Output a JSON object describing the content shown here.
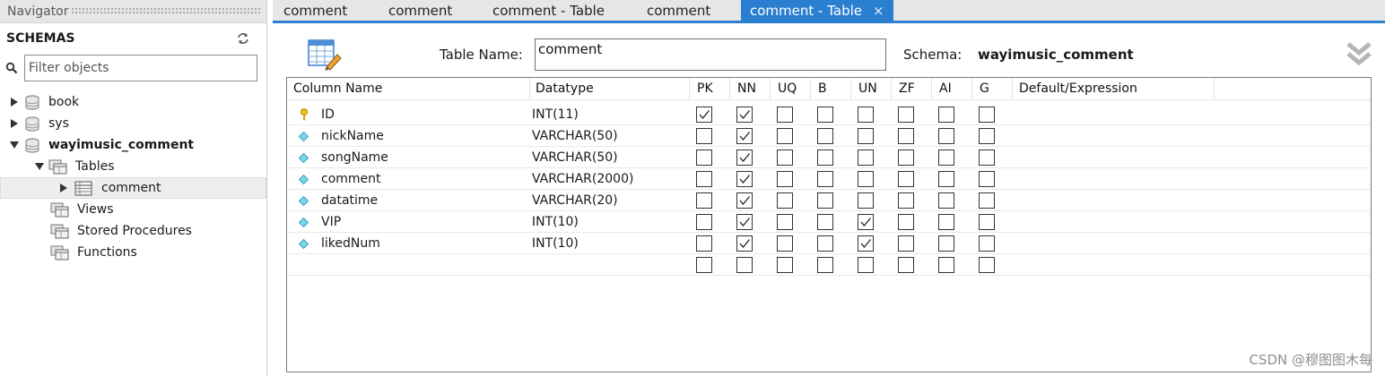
{
  "navigator": {
    "header": "Navigator",
    "schemas_title": "SCHEMAS",
    "filter_placeholder": "Filter objects",
    "schemas": [
      {
        "name": "book"
      },
      {
        "name": "sys"
      },
      {
        "name": "wayimusic_comment"
      }
    ],
    "nodes": {
      "tables": "Tables",
      "table_comment": "comment",
      "views": "Views",
      "stored_procedures": "Stored Procedures",
      "functions": "Functions"
    }
  },
  "tabs": [
    {
      "label": "comment"
    },
    {
      "label": "comment"
    },
    {
      "label": "comment - Table"
    },
    {
      "label": "comment"
    },
    {
      "label": "comment - Table",
      "active": true,
      "close": "×"
    }
  ],
  "editor": {
    "table_name_label": "Table Name:",
    "table_name_value": "comment",
    "schema_label": "Schema:",
    "schema_value": "wayimusic_comment"
  },
  "grid": {
    "headers": {
      "column_name": "Column Name",
      "datatype": "Datatype",
      "pk": "PK",
      "nn": "NN",
      "uq": "UQ",
      "b": "B",
      "un": "UN",
      "zf": "ZF",
      "ai": "AI",
      "g": "G",
      "default": "Default/Expression"
    },
    "rows": [
      {
        "name": "ID",
        "type": "INT(11)",
        "icon": "key-icon",
        "flags": [
          true,
          true,
          false,
          false,
          false,
          false,
          false,
          false
        ]
      },
      {
        "name": "nickName",
        "type": "VARCHAR(50)",
        "icon": "diamond-icon",
        "flags": [
          false,
          true,
          false,
          false,
          false,
          false,
          false,
          false
        ]
      },
      {
        "name": "songName",
        "type": "VARCHAR(50)",
        "icon": "diamond-icon",
        "flags": [
          false,
          true,
          false,
          false,
          false,
          false,
          false,
          false
        ]
      },
      {
        "name": "comment",
        "type": "VARCHAR(2000)",
        "icon": "diamond-icon",
        "flags": [
          false,
          true,
          false,
          false,
          false,
          false,
          false,
          false
        ]
      },
      {
        "name": "datatime",
        "type": "VARCHAR(20)",
        "icon": "diamond-icon",
        "flags": [
          false,
          true,
          false,
          false,
          false,
          false,
          false,
          false
        ]
      },
      {
        "name": "VIP",
        "type": "INT(10)",
        "icon": "diamond-icon",
        "flags": [
          false,
          true,
          false,
          false,
          true,
          false,
          false,
          false
        ]
      },
      {
        "name": "likedNum",
        "type": "INT(10)",
        "icon": "diamond-icon",
        "flags": [
          false,
          true,
          false,
          false,
          true,
          false,
          false,
          false
        ]
      },
      {
        "name": "",
        "type": "",
        "icon": "",
        "flags": [
          false,
          false,
          false,
          false,
          false,
          false,
          false,
          false
        ]
      }
    ]
  },
  "watermark": "CSDN @穆图图木每",
  "colors": {
    "accent": "#2b7fd0",
    "tab_bar": "#e6e6e6",
    "selected_row": "#eeeeee"
  }
}
